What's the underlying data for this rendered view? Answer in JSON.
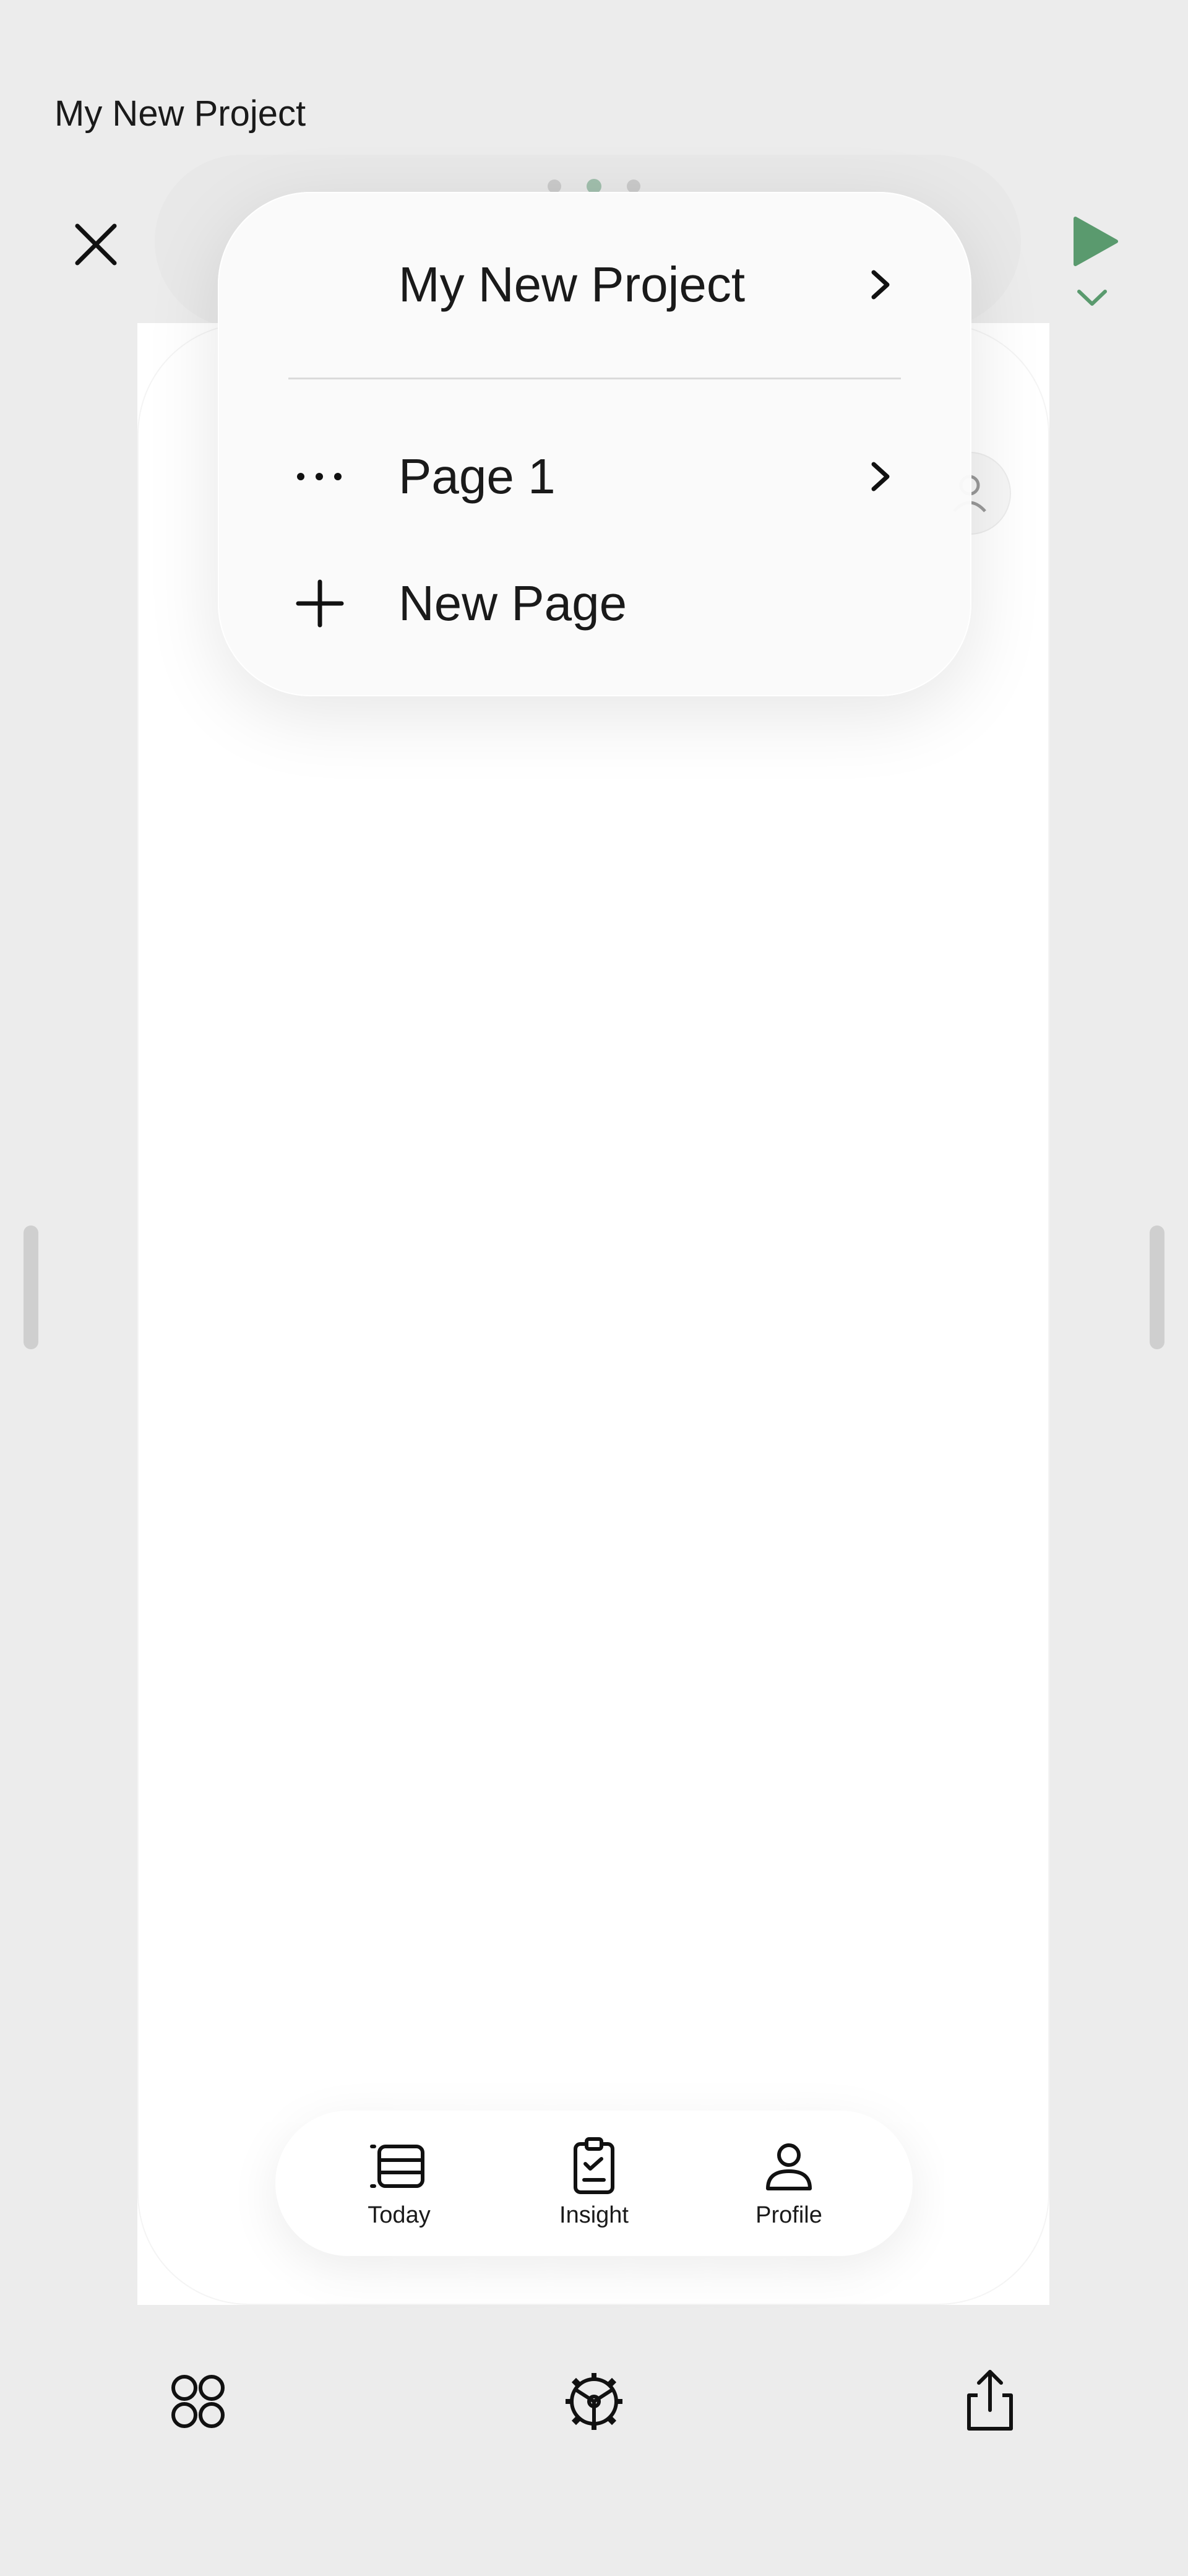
{
  "app": {
    "title": "My New Project"
  },
  "menu": {
    "project_label": "My New Project",
    "page_label": "Page 1",
    "new_page_label": "New Page"
  },
  "tabbar": {
    "tabs": [
      {
        "label": "Today",
        "icon": "today-list-icon"
      },
      {
        "label": "Insight",
        "icon": "clipboard-check-icon"
      },
      {
        "label": "Profile",
        "icon": "person-icon"
      }
    ]
  },
  "toolbar": {
    "left_icon": "components-grid-icon",
    "center_icon": "settings-gear-icon",
    "right_icon": "share-icon"
  },
  "colors": {
    "background": "#ececec",
    "accent_green": "#5a9a6e",
    "active_dot": "#4f9068",
    "inactive_dot": "#a8a8a8"
  }
}
